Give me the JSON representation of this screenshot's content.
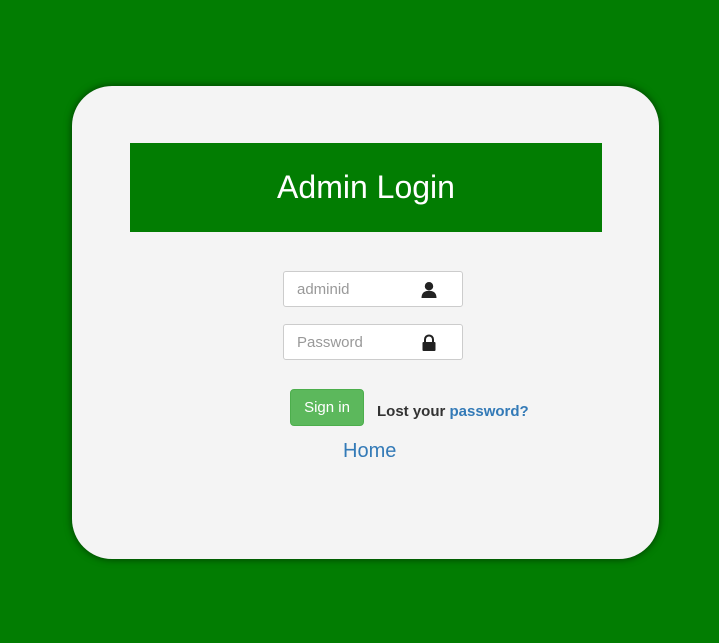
{
  "login": {
    "title": "Admin Login",
    "username_placeholder": "adminid",
    "password_placeholder": "Password",
    "signin_label": "Sign in",
    "lost_text": "Lost your ",
    "password_link": "password?",
    "home_link": "Home"
  },
  "icons": {
    "username": "user-icon",
    "password": "lock-icon"
  },
  "colors": {
    "background": "#027d02",
    "card": "#f4f4f4",
    "banner": "#027d02",
    "button": "#5cb85c",
    "link": "#337ab7"
  }
}
